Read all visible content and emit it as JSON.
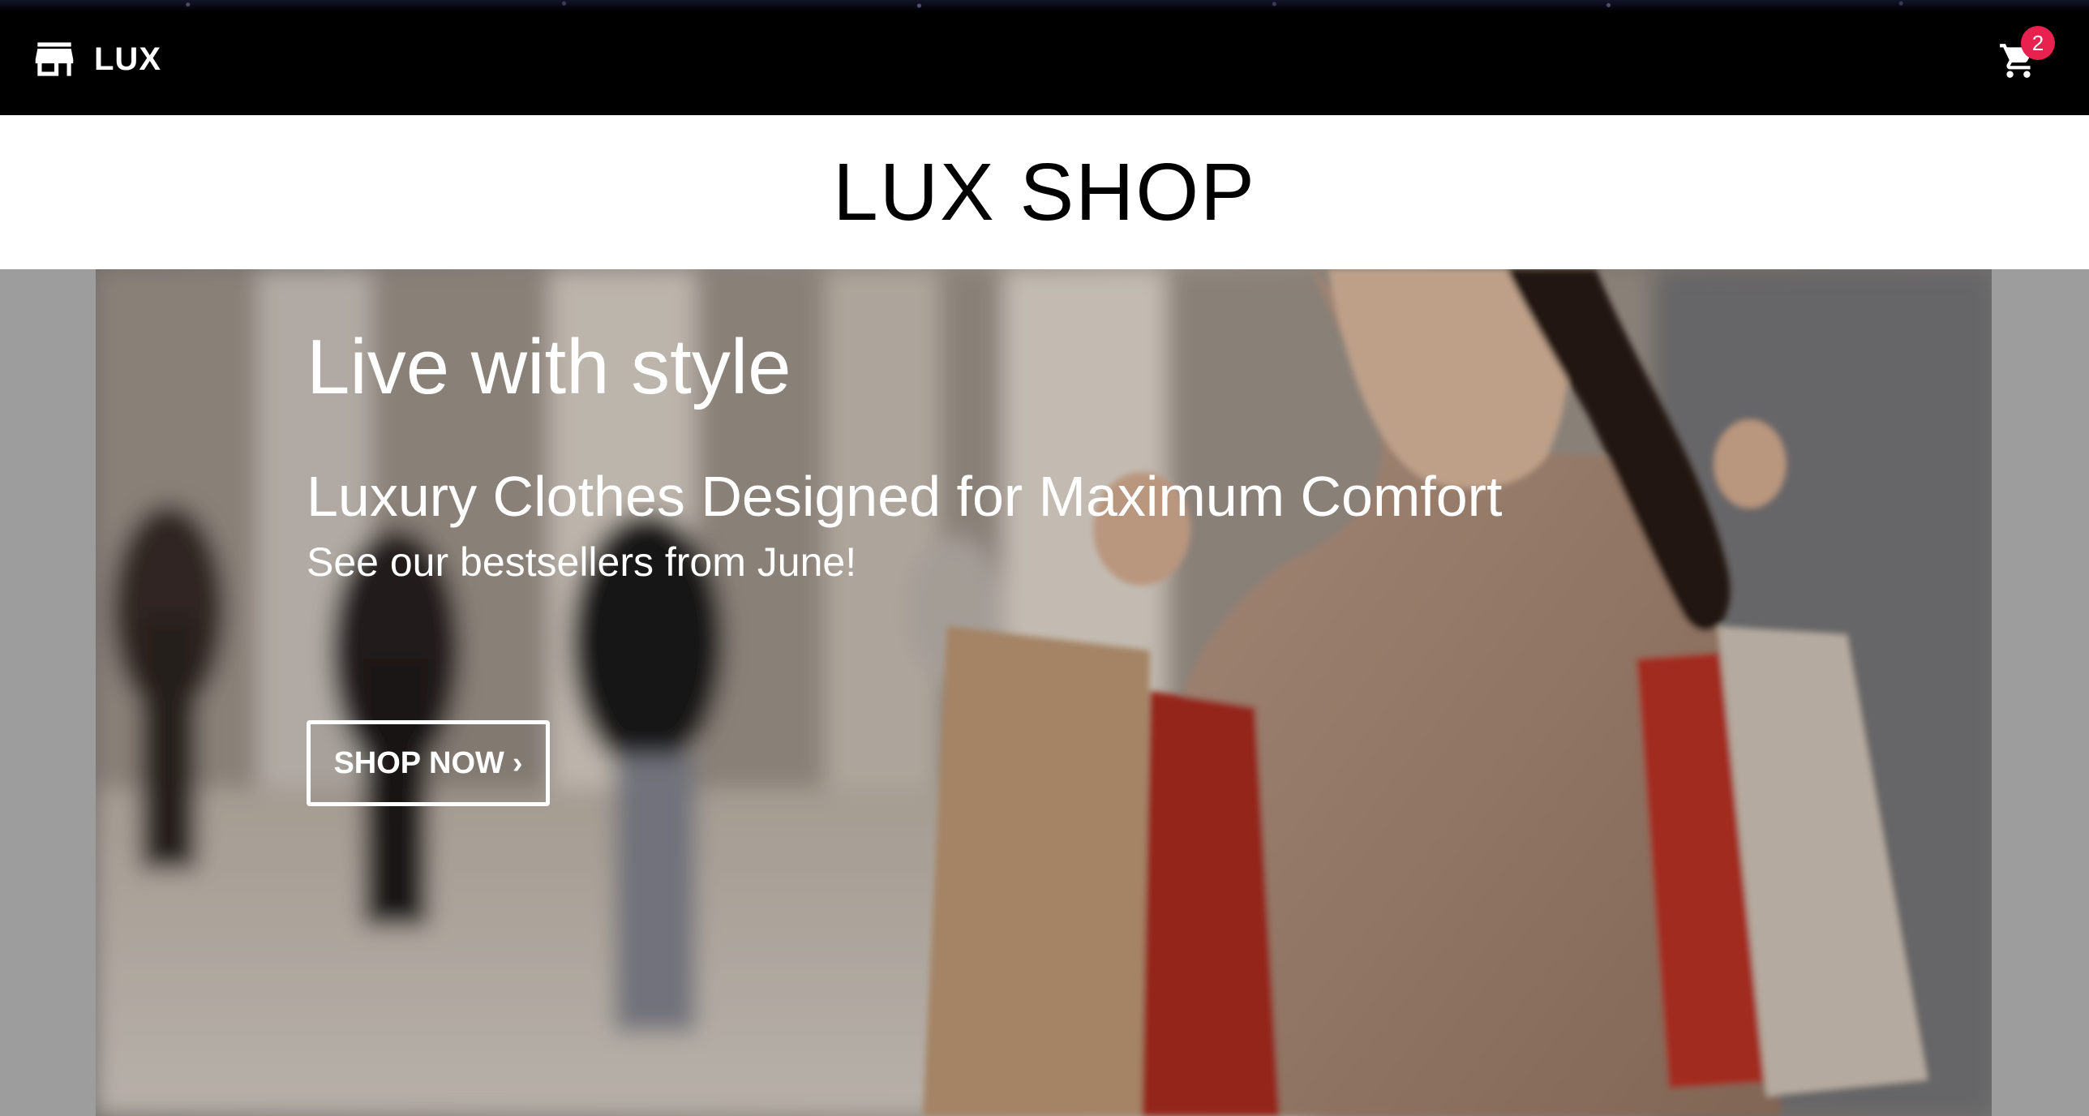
{
  "nav": {
    "brand_name": "LUX",
    "brand_icon": "store-icon",
    "cart_icon": "cart-icon",
    "cart_count": "2",
    "badge_color": "#e8214f"
  },
  "page": {
    "title": "LUX SHOP"
  },
  "hero": {
    "headline": "Live with style",
    "subheadline": "Luxury Clothes Designed for Maximum Comfort",
    "note": "See our bestsellers from June!",
    "cta_label": "SHOP NOW",
    "cta_icon": "chevron-right-icon",
    "image": "hero-photo"
  }
}
